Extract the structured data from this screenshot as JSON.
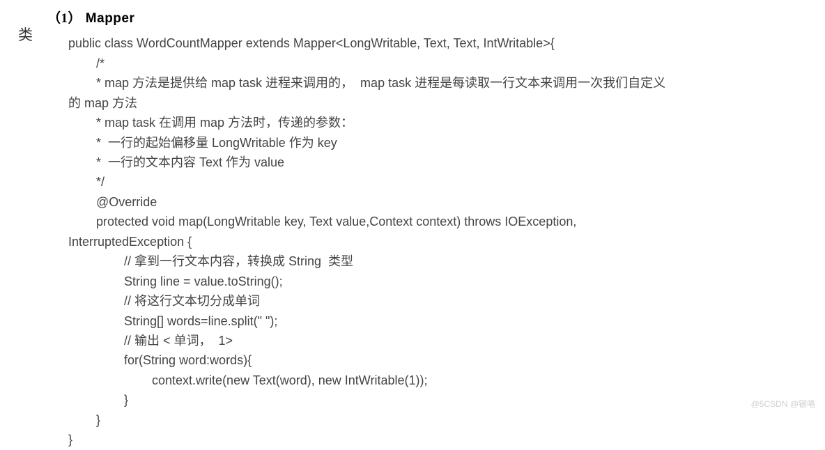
{
  "side_label": "类",
  "heading_prefix": "（1）",
  "heading_title": "Mapper",
  "code": {
    "l01": "public class WordCountMapper extends Mapper<LongWritable, Text, Text, IntWritable>{",
    "l02": "        /*",
    "l03a": "        * map 方法是提供给 map task 进程来调用的，  map task 进程是每读取一行文本来调用一次我们自定义",
    "l03b": "的 map 方法",
    "l04": "        * map task 在调用 map 方法时，传递的参数：",
    "l05": "        *  一行的起始偏移量 LongWritable 作为 key",
    "l06": "        *  一行的文本内容 Text 作为 value",
    "l07": "        */",
    "l08": "        @Override",
    "l09a": "        protected void map(LongWritable key, Text value,Context context) throws IOException,",
    "l09b": "InterruptedException {",
    "l10": "                // 拿到一行文本内容，转换成 String  类型",
    "l11": "                String line = value.toString();",
    "l12": "                // 将这行文本切分成单词",
    "l13": "                String[] words=line.split(\" \");",
    "l14": "                // 输出 < 单词，  1>",
    "l15": "                for(String word:words){",
    "l16": "                        context.write(new Text(word), new IntWritable(1));",
    "l17": "                }",
    "l18": "        }",
    "l19": "}"
  },
  "watermark": "@5CSDN @银咯"
}
